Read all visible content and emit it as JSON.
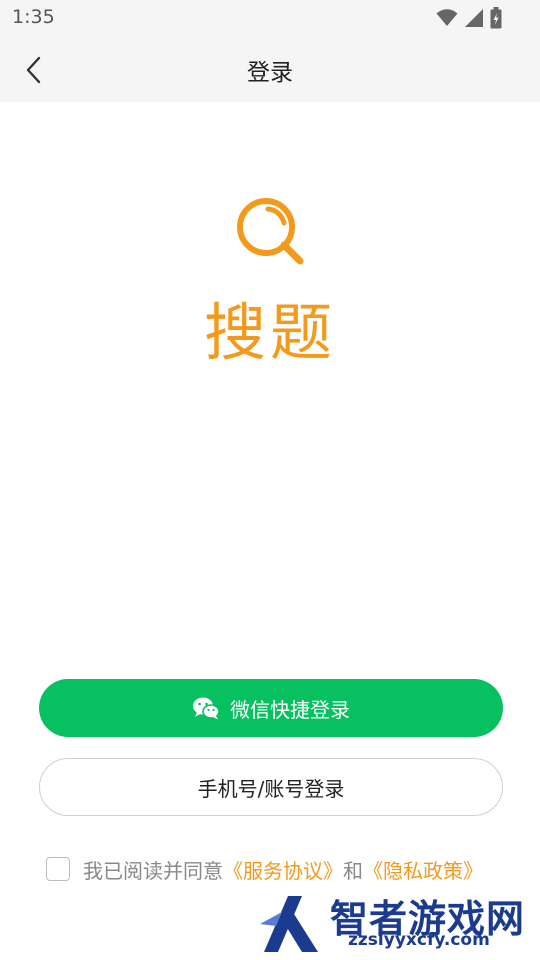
{
  "status_bar": {
    "time": "1:35",
    "icons": [
      "wifi-icon",
      "signal-icon",
      "battery-icon"
    ]
  },
  "nav": {
    "title": "登录",
    "back_icon": "chevron-left-icon"
  },
  "app": {
    "logo_icon": "search-icon",
    "name": "搜题",
    "accent_color": "#f39a1c"
  },
  "buttons": {
    "wechat_label": "微信快捷登录",
    "wechat_icon": "wechat-icon",
    "wechat_color": "#07c160",
    "phone_label": "手机号/账号登录"
  },
  "agreement": {
    "prefix": "我已阅读并同意",
    "service_link": "《服务协议》",
    "conjunction": "和",
    "privacy_link": "《隐私政策》",
    "checked": false
  },
  "watermark": {
    "title": "智者游戏网",
    "url": "zzslyyxcfy.com"
  }
}
